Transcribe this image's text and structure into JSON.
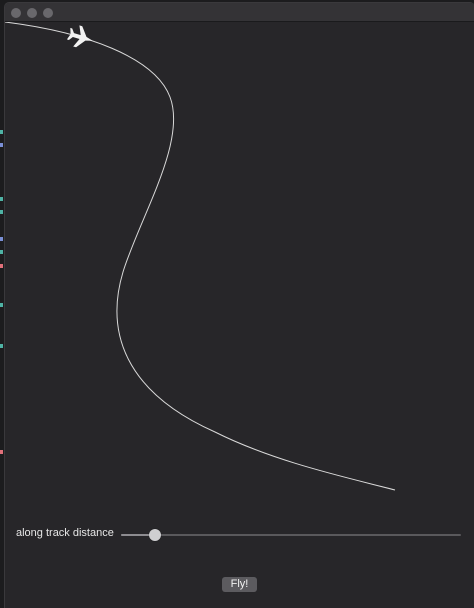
{
  "window": {
    "title": ""
  },
  "track": {
    "stroke_color": "#d9d9d9",
    "aircraft_icon": "airplane-icon",
    "aircraft_color": "#f2f2f2"
  },
  "controls": {
    "slider_label": "along track distance",
    "slider_value_fraction": 0.1,
    "fly_button_label": "Fly!"
  },
  "colors": {
    "background": "#272629",
    "titlebar": "#343336",
    "button": "#5c5b5f"
  }
}
